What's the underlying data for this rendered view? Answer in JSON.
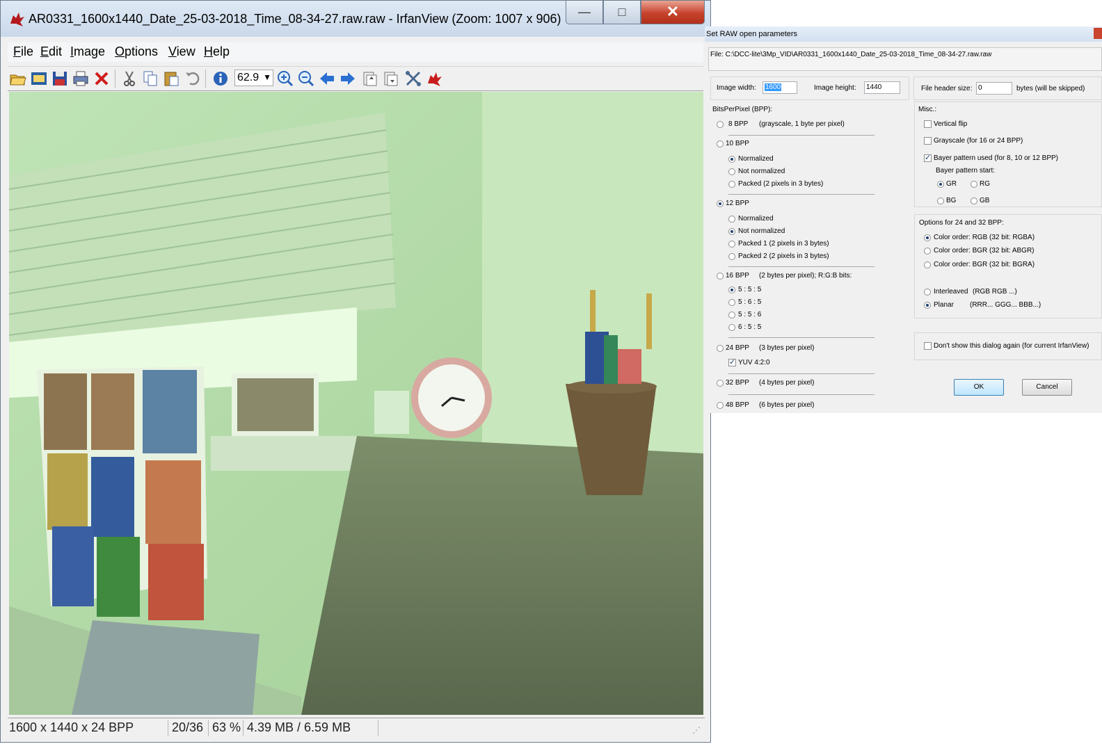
{
  "window": {
    "title": "AR0331_1600x1440_Date_25-03-2018_Time_08-34-27.raw.raw - IrfanView (Zoom: 1007 x 906)",
    "buttons": {
      "minimize": "—",
      "maximize": "□",
      "close": "✕"
    }
  },
  "menu": [
    {
      "u": "F",
      "rest": "ile"
    },
    {
      "u": "E",
      "rest": "dit"
    },
    {
      "u": "I",
      "rest": "mage"
    },
    {
      "u": "O",
      "rest": "ptions"
    },
    {
      "u": "V",
      "rest": "iew"
    },
    {
      "u": "H",
      "rest": "elp"
    }
  ],
  "toolbar": {
    "zoom_value": "62.9",
    "icons": [
      "open-icon",
      "slideshow-icon",
      "save-icon",
      "print-icon",
      "delete-icon",
      "cut-icon",
      "copy-icon",
      "paste-icon",
      "undo-icon",
      "info-icon",
      "zoom-in-icon",
      "zoom-out-icon",
      "previous-icon",
      "next-icon",
      "page-up-icon",
      "page-down-icon",
      "settings-icon",
      "irfanview-icon"
    ]
  },
  "status": {
    "dimensions": "1600 x 1440 x 24 BPP",
    "index": "20/36",
    "zoom": "63 %",
    "size": "4.39 MB / 6.59 MB"
  },
  "dialog": {
    "title": "Set RAW open parameters",
    "file": "File: C:\\DCC-lite\\3Mp_VID\\AR0331_1600x1440_Date_25-03-2018_Time_08-34-27.raw.raw",
    "width_label": "Image width:",
    "width_value": "1600",
    "height_label": "Image height:",
    "height_value": "1440",
    "header_label": "File header size:",
    "header_value": "0",
    "header_suffix": "bytes (will be skipped)",
    "bpp_label": "BitsPerPixel (BPP):",
    "bpp8": {
      "label": "8 BPP",
      "desc": "(grayscale, 1 byte per pixel)"
    },
    "bpp10": {
      "label": "10 BPP",
      "options": [
        "Normalized",
        "Not normalized",
        "Packed (2 pixels in 3 bytes)"
      ]
    },
    "bpp12": {
      "label": "12 BPP",
      "options": [
        "Normalized",
        "Not normalized",
        "Packed 1 (2 pixels in 3 bytes)",
        "Packed 2 (2 pixels in 3 bytes)"
      ]
    },
    "bpp16": {
      "label": "16 BPP",
      "desc": "(2 bytes per pixel); R:G:B bits:",
      "options": [
        "5 : 5 : 5",
        "5 : 6 : 5",
        "5 : 5 : 6",
        "6 : 5 : 5"
      ]
    },
    "bpp24": {
      "label": "24 BPP",
      "desc": "(3 bytes per pixel)",
      "yuv": "YUV 4:2:0"
    },
    "bpp32": {
      "label": "32 BPP",
      "desc": "(4 bytes per pixel)"
    },
    "bpp48": {
      "label": "48 BPP",
      "desc": "(6 bytes per pixel)"
    },
    "misc_label": "Misc.:",
    "vflip": "Vertical flip",
    "grayscale": "Grayscale (for 16 or 24 BPP)",
    "bayer": "Bayer pattern used (for 8, 10 or 12 BPP)",
    "bayer_start": "Bayer pattern start:",
    "bayer_opts": [
      "GR",
      "RG",
      "BG",
      "GB"
    ],
    "opts24_label": "Options for 24 and 32 BPP:",
    "order_opts": [
      "Color order: RGB (32 bit: RGBA)",
      "Color order: BGR (32 bit: ABGR)",
      "Color order: BGR (32 bit: BGRA)"
    ],
    "interleaved": {
      "label": "Interleaved",
      "desc": "(RGB RGB ...)"
    },
    "planar": {
      "label": "Planar",
      "desc": "(RRR... GGG... BBB...)"
    },
    "dont_show": "Don't show this dialog again (for current IrfanView)",
    "ok": "OK",
    "cancel": "Cancel"
  }
}
